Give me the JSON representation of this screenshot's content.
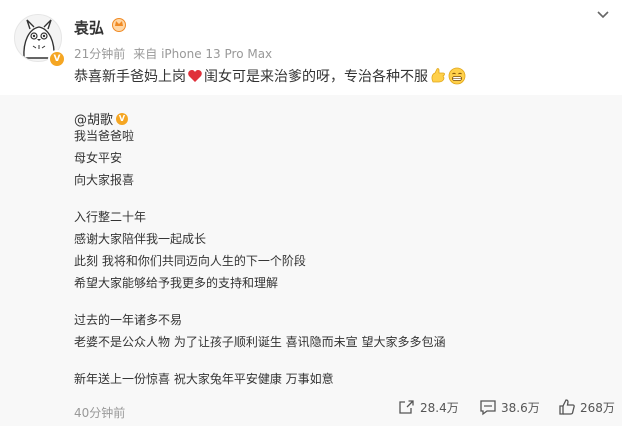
{
  "post": {
    "author": "袁弘",
    "time": "21分钟前",
    "source": "来自 iPhone 13 Pro Max",
    "text_part1": "恭喜新手爸妈上岗",
    "text_part2": "闺女可是来治爹的呀，专治各种不服"
  },
  "repost": {
    "mention": "@胡歌",
    "lines": [
      "我当爸爸啦",
      "母女平安",
      "向大家报喜",
      "入行整二十年",
      "感谢大家陪伴我一起成长",
      "此刻 我将和你们共同迈向人生的下一个阶段",
      "希望大家能够给予我更多的支持和理解",
      "过去的一年诸多不易",
      "老婆不是公众人物 为了让孩子顺利诞生 喜讯隐而未宣 望大家多多包涵",
      "新年送上一份惊喜 祝大家兔年平安健康 万事如意"
    ],
    "time": "40分钟前",
    "shares": "28.4万",
    "comments": "38.6万",
    "likes": "268万"
  },
  "icons": {
    "verified": "verified-badge-icon",
    "crown": "crown-icon",
    "menu": "chevron-down-icon",
    "heart": "red-heart-icon",
    "emoji1": "hand-emoji-icon",
    "emoji2": "grin-emoji-icon",
    "share": "share-icon",
    "comment": "comment-icon",
    "like": "thumbs-up-icon"
  },
  "colors": {
    "verified": "#f5a623",
    "heart": "#e0303a",
    "meta": "#999999",
    "repost_bg": "#f8f8f8"
  }
}
